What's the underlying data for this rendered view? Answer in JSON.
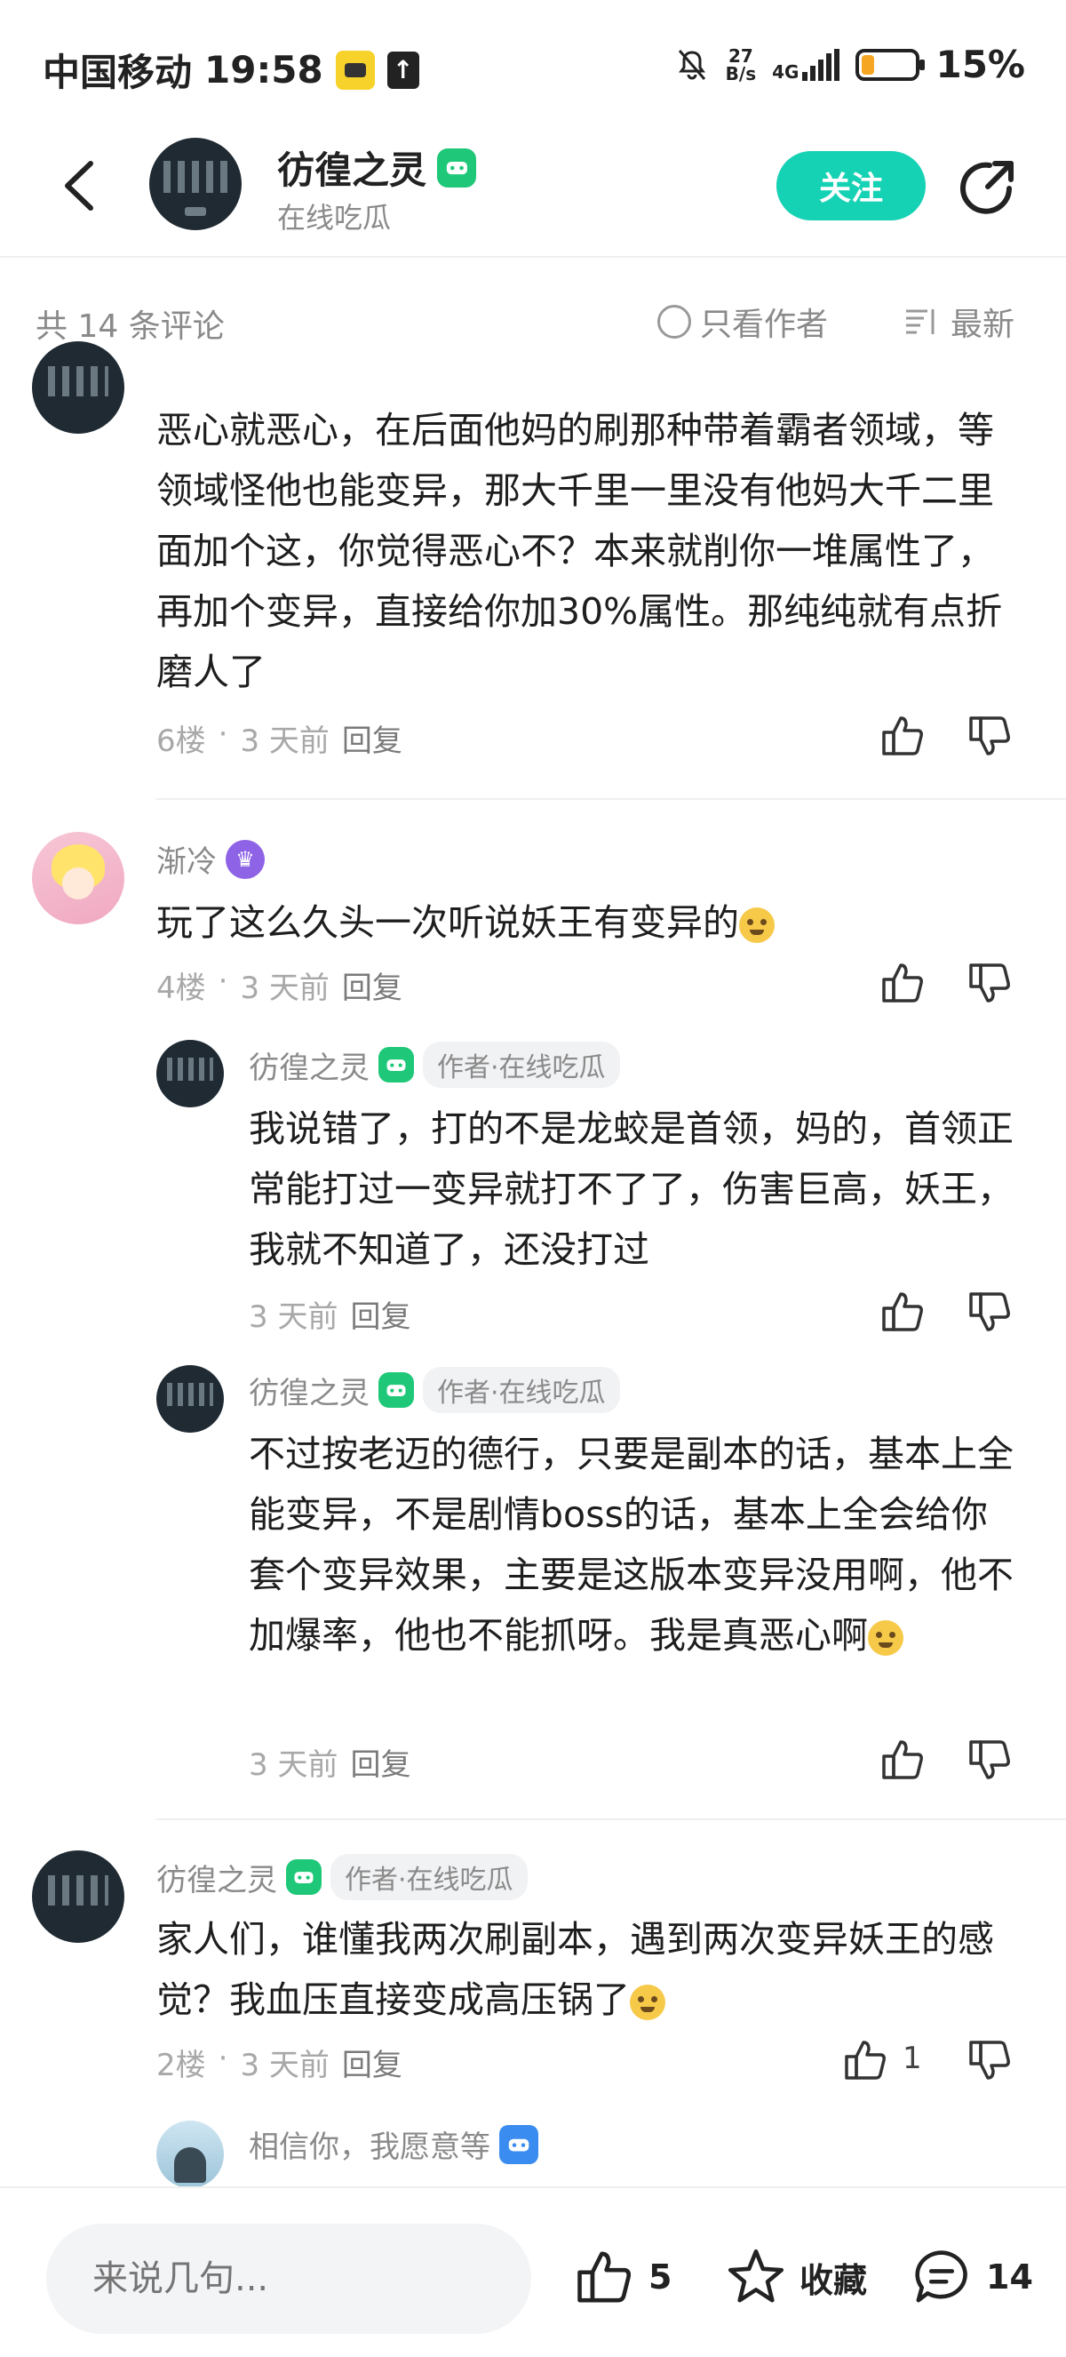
{
  "status_bar": {
    "carrier": "中国移动",
    "time": "19:58",
    "speed_value": "27",
    "speed_unit": "B/s",
    "network": "4G",
    "battery": "15%",
    "battery_level": 0.15
  },
  "header": {
    "name": "彷徨之灵",
    "subtitle": "在线吃瓜",
    "follow_label": "关注",
    "accent_color": "#16d2b4"
  },
  "sort": {
    "total": "共 14 条评论",
    "only_author": "只看作者",
    "newest": "最新"
  },
  "comments": [
    {
      "text": "恶心就恶心，在后面他妈的刷那种带着霸者领域，等领域怪他也能变异，那大千里一里没有他妈大千二里面加个这，你觉得恶心不？本来就削你一堆属性了，再加个变异，直接给你加30%属性。那纯纯就有点折磨人了",
      "floor": "6楼",
      "time": "3 天前",
      "reply": "回复"
    },
    {
      "name": "渐冷",
      "text": "玩了这么久头一次听说妖王有变异的",
      "floor": "4楼",
      "time": "3 天前",
      "reply": "回复",
      "replies": [
        {
          "name": "彷徨之灵",
          "tag": "作者·在线吃瓜",
          "text": "我说错了，打的不是龙蛟是首领，妈的，首领正常能打过一变异就打不了了，伤害巨高，妖王，我就不知道了，还没打过",
          "time": "3 天前",
          "reply": "回复"
        },
        {
          "name": "彷徨之灵",
          "tag": "作者·在线吃瓜",
          "text": "不过按老迈的德行，只要是副本的话，基本上全能变异，不是剧情boss的话，基本上全会给你套个变异效果，主要是这版本变异没用啊，他不加爆率，他也不能抓呀。我是真恶心啊",
          "time": "3 天前",
          "reply": "回复"
        }
      ]
    },
    {
      "name": "彷徨之灵",
      "tag": "作者·在线吃瓜",
      "text": "家人们，谁懂我两次刷副本，遇到两次变异妖王的感觉？我血压直接变成高压锅了",
      "floor": "2楼",
      "time": "3 天前",
      "reply": "回复",
      "likes": "1",
      "reply_preview_name": "相信你，我愿意等"
    }
  ],
  "bottom_bar": {
    "input_placeholder": "来说几句...",
    "likes": "5",
    "favorite": "收藏",
    "comments": "14"
  },
  "icons": [
    "back-icon",
    "share-icon",
    "game-badge-icon",
    "thumb-up-icon",
    "thumb-down-icon",
    "star-icon",
    "comment-icon",
    "trophy-icon",
    "sort-icon"
  ]
}
